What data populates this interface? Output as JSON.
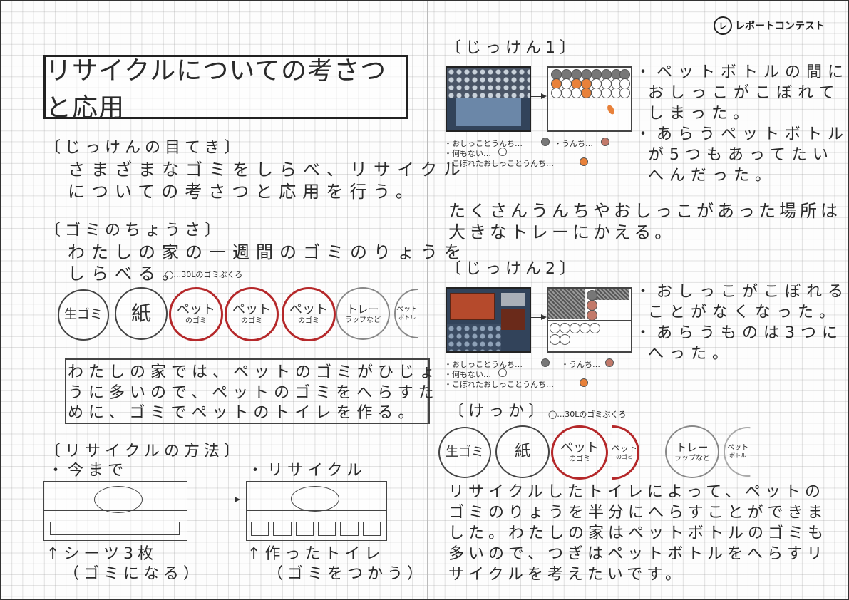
{
  "logo": {
    "mark": "レ",
    "text": "レポートコンテスト"
  },
  "title": "リサイクルについての考さつと応用",
  "left": {
    "purpose": {
      "heading": "〔じっけんの目てき〕",
      "lines": [
        "さまざまなゴミをしらべ、リサイクル",
        "についての考さつと応用を行う。"
      ]
    },
    "survey": {
      "heading": "〔ゴミのちょうさ〕",
      "lines": [
        "わたしの家の一週間のゴミのりょうを",
        "しらべる。"
      ],
      "legend": "◯…30Lのゴミぶくろ",
      "circles": [
        {
          "label": "生ゴミ",
          "sub": ""
        },
        {
          "label": "紙",
          "sub": ""
        },
        {
          "label": "ペット",
          "sub": "のゴミ"
        },
        {
          "label": "ペット",
          "sub": "のゴミ"
        },
        {
          "label": "ペット",
          "sub": "のゴミ"
        },
        {
          "label": "トレー",
          "sub": "ラップなど"
        },
        {
          "label": "ペット",
          "sub": "ボトル"
        }
      ]
    },
    "note": [
      "わたしの家では、ペットのゴミがひじょ",
      "うに多いので、ペットのゴミをへらすた",
      "めに、ゴミでペットのトイレを作る。"
    ],
    "method": {
      "heading": "〔リサイクルの方法〕",
      "before_label": "・今まで",
      "after_label": "・リサイクル",
      "before_caption": [
        "↑シーツ3枚",
        "（ゴミになる）"
      ],
      "after_caption": [
        "↑作ったトイレ",
        "（ゴミをつかう）"
      ]
    }
  },
  "right": {
    "exp1": {
      "heading": "〔じっけん1〕",
      "legend": [
        "・おしっことうんち…",
        "・うんち…",
        "・何もない…",
        "・こぼれたおしっことうんち…"
      ],
      "notes": [
        "・ペットボトルの間に",
        "おしっこがこぼれて",
        "しまった。",
        "・あらうペットボトル",
        "が5つもあってたい",
        "へんだった。"
      ]
    },
    "mid_note": [
      "たくさんうんちやおしっこがあった場所は",
      "大きなトレーにかえる。"
    ],
    "exp2": {
      "heading": "〔じっけん2〕",
      "legend": [
        "・おしっことうんち…",
        "・うんち…",
        "・何もない…",
        "・こぼれたおしっことうんち…"
      ],
      "notes": [
        "・おしっこがこぼれる",
        "ことがなくなった。",
        "・あらうものは3つに",
        "へった。"
      ]
    },
    "result": {
      "heading": "〔けっか〕",
      "legend": "◯…30Lのゴミぶくろ",
      "circles": [
        {
          "label": "生ゴミ",
          "sub": ""
        },
        {
          "label": "紙",
          "sub": ""
        },
        {
          "label": "ペット",
          "sub": "のゴミ"
        },
        {
          "label": "ペット",
          "sub": "のゴミ"
        },
        {
          "label": "トレー",
          "sub": "ラップなど"
        },
        {
          "label": "ペット",
          "sub": "ボトル"
        }
      ]
    },
    "conclusion": [
      "リサイクルしたトイレによって、ペットの",
      "ゴミのりょうを半分にへらすことができま",
      "した。わたしの家はペットボトルのゴミも",
      "多いので、つぎはペットボトルをへらすリ",
      "サイクルを考えたいです。"
    ]
  },
  "colors": {
    "ink": "#2a2a2a",
    "red_circle": "#b5282a",
    "orange_dot": "#e8813a",
    "gray_dot": "#777777",
    "photo_bg": "#32435a"
  }
}
